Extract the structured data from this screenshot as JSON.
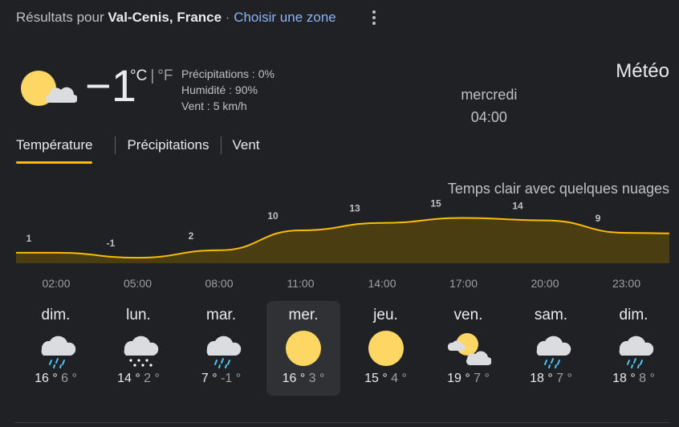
{
  "header": {
    "prefix": "Résultats pour ",
    "location": "Val-Cenis, France",
    "separator": " · ",
    "choose_zone": "Choisir une zone"
  },
  "current": {
    "icon": "sun-cloud-icon",
    "temperature": "−1",
    "unit_c": "°C",
    "unit_sep": "|",
    "unit_f": "°F",
    "precipitation": "Précipitations : 0%",
    "humidity": "Humidité : 90%",
    "wind": "Vent : 5 km/h"
  },
  "summary": {
    "title": "Météo",
    "datetime": "mercredi 04:00",
    "condition": "Temps clair avec quelques nuages"
  },
  "tabs": [
    "Température",
    "Précipitations",
    "Vent"
  ],
  "active_tab": 0,
  "colors": {
    "accent": "#fbbc04",
    "chart_fill": "#4a3d12",
    "chart_line": "#fbbc04",
    "sun": "#fdd663",
    "cloud": "#dadce0"
  },
  "chart_data": {
    "type": "area",
    "x": [
      "02:00",
      "05:00",
      "08:00",
      "11:00",
      "14:00",
      "17:00",
      "20:00",
      "23:00"
    ],
    "values": [
      1,
      -1,
      2,
      10,
      13,
      15,
      14,
      9
    ],
    "labels": [
      "1",
      "-1",
      "2",
      "10",
      "13",
      "15",
      "14",
      "9"
    ],
    "grid": false
  },
  "days": [
    {
      "name": "dim.",
      "icon": "rain-icon",
      "hi": "16 °",
      "lo": "6 °"
    },
    {
      "name": "lun.",
      "icon": "snow-icon",
      "hi": "14 °",
      "lo": "2 °"
    },
    {
      "name": "mar.",
      "icon": "rain-icon",
      "hi": "7 °",
      "lo": "-1 °"
    },
    {
      "name": "mer.",
      "icon": "sun-icon",
      "hi": "16 °",
      "lo": "3 °"
    },
    {
      "name": "jeu.",
      "icon": "sun-icon",
      "hi": "15 °",
      "lo": "4 °"
    },
    {
      "name": "ven.",
      "icon": "partly-cloudy-icon",
      "hi": "19 °",
      "lo": "7 °"
    },
    {
      "name": "sam.",
      "icon": "rain-icon",
      "hi": "18 °",
      "lo": "7 °"
    },
    {
      "name": "dim.",
      "icon": "rain-icon",
      "hi": "18 °",
      "lo": "8 °"
    }
  ],
  "selected_day": 3
}
